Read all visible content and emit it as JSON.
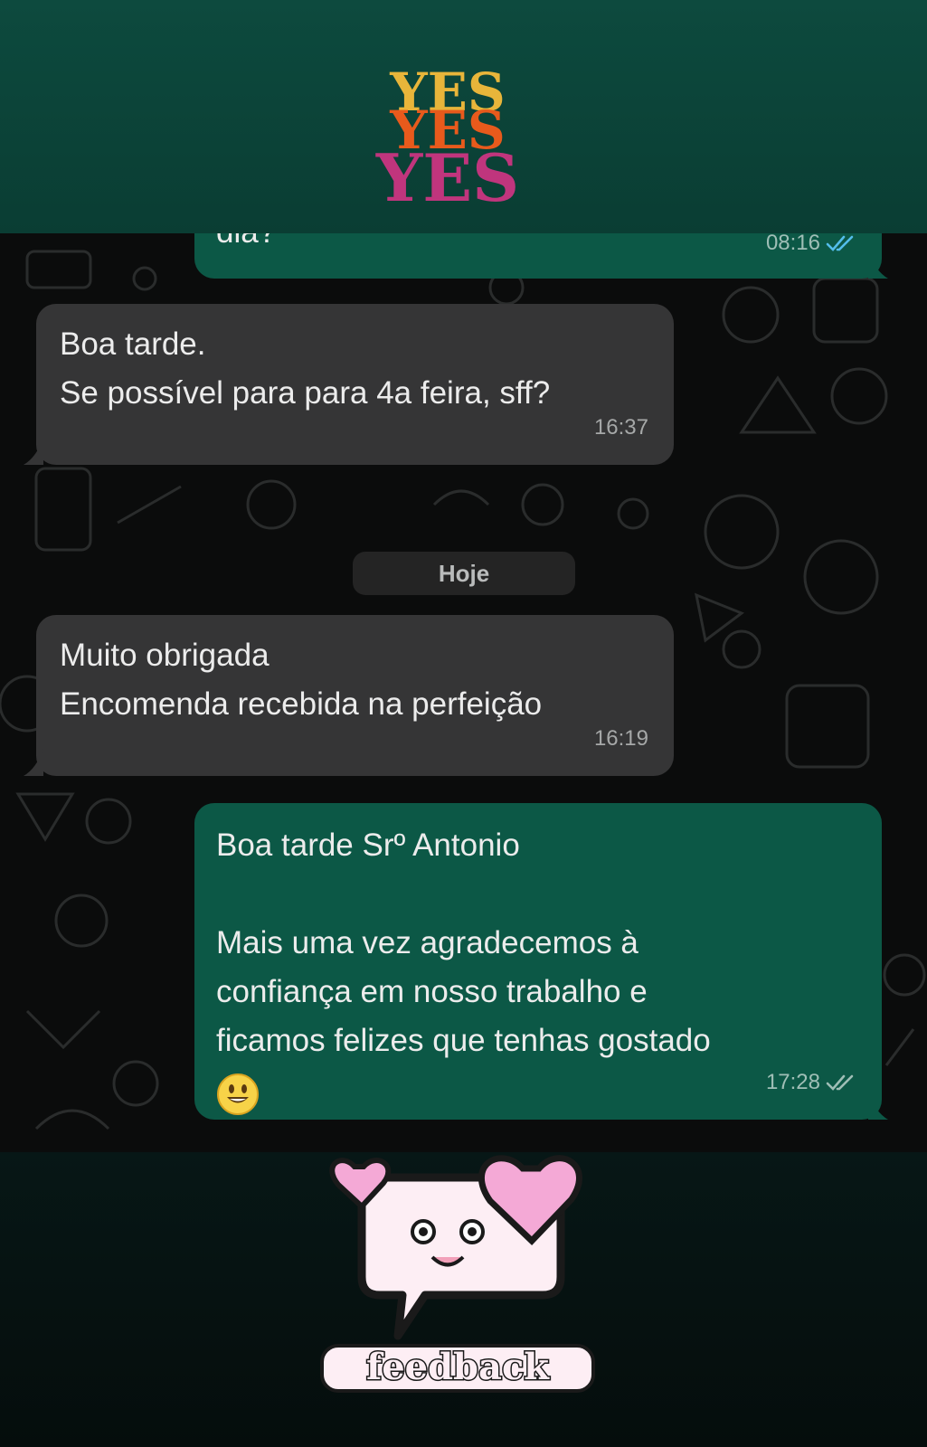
{
  "logo": {
    "words": [
      "YES",
      "YES",
      "YES"
    ],
    "colors": [
      "#e8b53a",
      "#e85a1c",
      "#c0357d"
    ]
  },
  "messages": [
    {
      "side": "out",
      "text": "dia?",
      "time": "08:16",
      "ticks": "read"
    },
    {
      "side": "in",
      "text": "Boa tarde.\nSe possível para para 4a feira, sff?",
      "time": "16:37"
    },
    {
      "side": "in",
      "text": "Muito obrigada\nEncomenda recebida na perfeição",
      "time": "16:19"
    },
    {
      "side": "out",
      "text": "Boa tarde Srº Antonio\n\nMais uma vez agradecemos à\nconfiança em nosso trabalho e\nficamos felizes que tenhas gostado",
      "emoji": "smiley-emoji",
      "time": "17:28",
      "ticks": "delivered"
    }
  ],
  "day_separator": "Hoje",
  "sticker": {
    "label": "feedback",
    "icon": "speech-bubble-hearts-icon"
  },
  "colors": {
    "header": "#0d4a3e",
    "incoming_bubble": "#353536",
    "outgoing_bubble": "#0c5846",
    "read_ticks": "#53bdeb",
    "heart_pink": "#f4a9d6"
  }
}
